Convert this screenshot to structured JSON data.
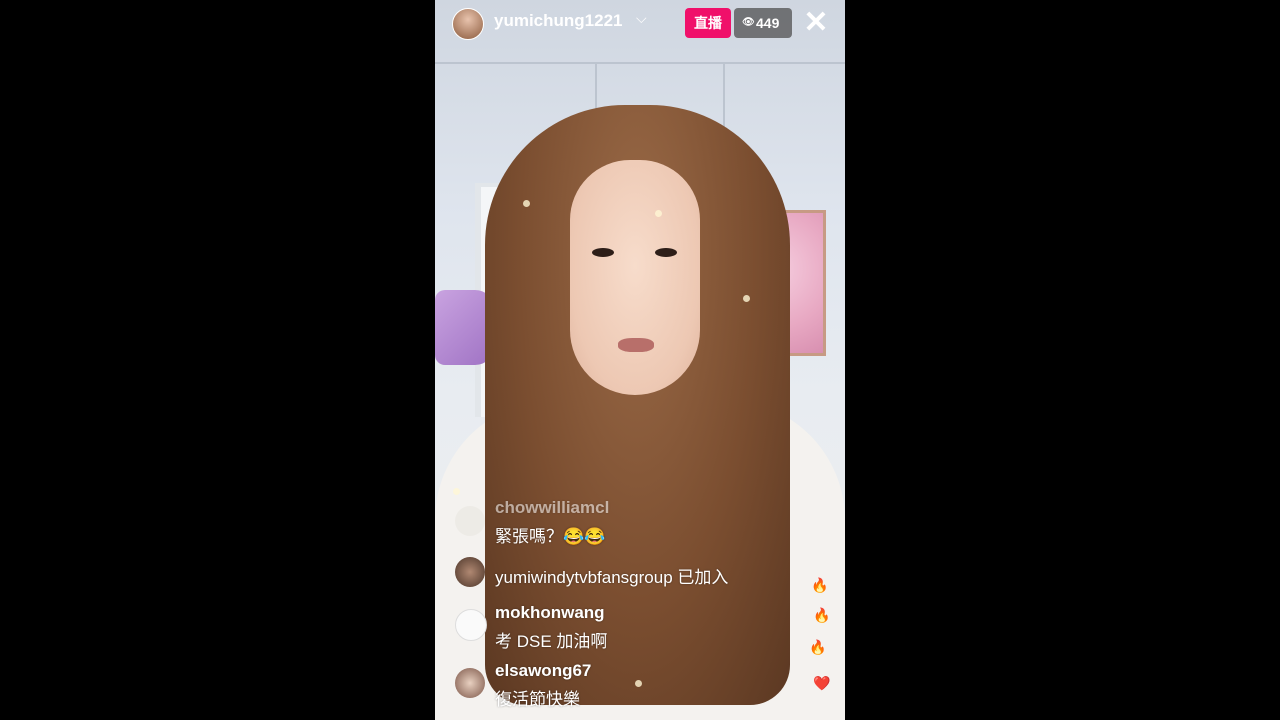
{
  "stream": {
    "host_name": "yumichung1221",
    "live_label": "直播",
    "viewer_count": "449",
    "icons": {
      "dropdown": "chevron-down-icon",
      "viewers": "eye-icon",
      "close": "close-icon"
    }
  },
  "comments": [
    {
      "user": "chowwilliamcl",
      "text": "緊張嗎？😂😂"
    },
    {
      "text": "yumiwindytvbfansgroup 已加入"
    },
    {
      "user": "mokhonwang",
      "text": "考 DSE 加油啊"
    },
    {
      "user": "elsawong67",
      "text": "復活節快樂"
    }
  ],
  "reactions": [
    "🔥",
    "🔥",
    "🔥",
    "❤️"
  ],
  "colors": {
    "live_badge": "#f0106a",
    "background": "#000000"
  }
}
